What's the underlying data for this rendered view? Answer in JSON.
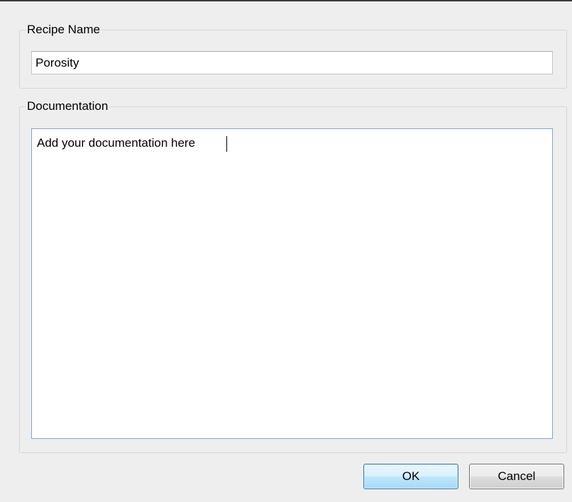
{
  "recipe_name": {
    "legend": "Recipe Name",
    "value": "Porosity"
  },
  "documentation": {
    "legend": "Documentation",
    "value": "Add your documentation here"
  },
  "buttons": {
    "ok_label": "OK",
    "cancel_label": "Cancel"
  },
  "colors": {
    "dialog_background": "#eeeeee",
    "focus_border": "#7ea6cf",
    "default_button_border": "#3c7fb1"
  }
}
